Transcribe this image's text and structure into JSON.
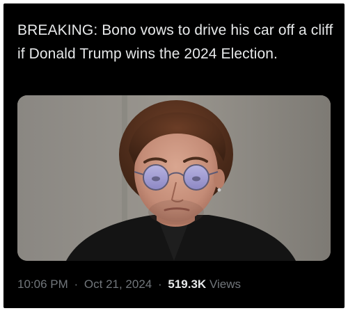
{
  "post": {
    "text": "BREAKING: Bono vows to drive his car off a cliff if Donald Trump wins the 2024 Election.",
    "media": {
      "description_icon": "photo-of-man-with-tinted-glasses"
    },
    "time": "10:06 PM",
    "separator": "·",
    "date": "Oct 21, 2024",
    "views_count": "519.3K",
    "views_label": "Views"
  },
  "colors": {
    "background": "#000000",
    "primary_text": "#e7e9ea",
    "secondary_text": "#71767b"
  }
}
